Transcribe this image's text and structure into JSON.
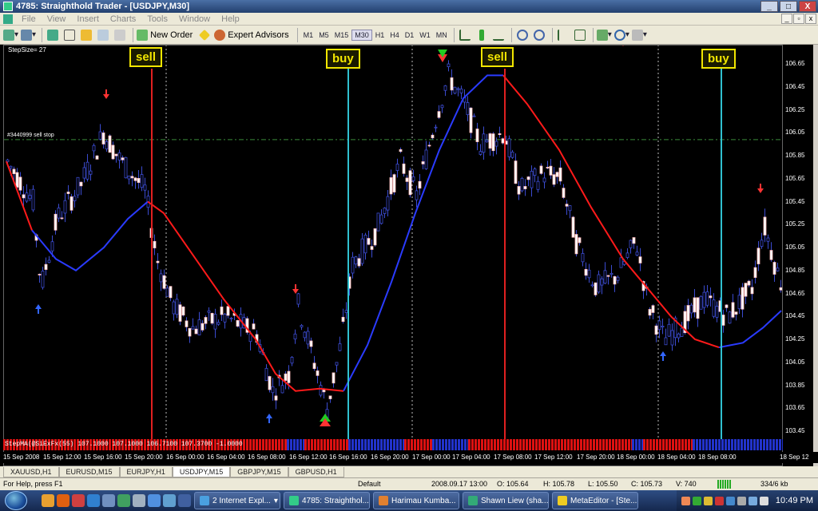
{
  "window": {
    "title": "4785: Straighthold Trader - [USDJPY,M30]",
    "minimize": "_",
    "maximize": "□",
    "close": "X"
  },
  "menu": [
    "File",
    "View",
    "Insert",
    "Charts",
    "Tools",
    "Window",
    "Help"
  ],
  "toolbar": {
    "new_order": "New Order",
    "expert_advisors": "Expert Advisors",
    "timeframes": [
      "M1",
      "M5",
      "M15",
      "M30",
      "H1",
      "H4",
      "D1",
      "W1",
      "MN"
    ],
    "active_timeframe": "M30"
  },
  "chart": {
    "stepsize": "StepSize= 27",
    "sell_stop_label": "#3440999 sell stop",
    "indicator_label": "StepMA(@SiExFx(55) 107.1000 107.1000 106.7100 107.3700 -1.0000",
    "signals": [
      {
        "label": "sell",
        "type": "sell"
      },
      {
        "label": "buy",
        "type": "buy"
      },
      {
        "label": "sell",
        "type": "sell"
      },
      {
        "label": "buy",
        "type": "buy"
      }
    ],
    "price_ticks": [
      "106.65",
      "106.45",
      "106.25",
      "106.05",
      "105.85",
      "105.65",
      "105.45",
      "105.25",
      "105.05",
      "104.85",
      "104.65",
      "104.45",
      "104.25",
      "104.05",
      "103.85",
      "103.65",
      "103.45"
    ],
    "time_ticks": [
      "15 Sep 2008",
      "15 Sep 12:00",
      "15 Sep 16:00",
      "15 Sep 20:00",
      "16 Sep 00:00",
      "16 Sep 04:00",
      "16 Sep 08:00",
      "16 Sep 12:00",
      "16 Sep 16:00",
      "16 Sep 20:00",
      "17 Sep 00:00",
      "17 Sep 04:00",
      "17 Sep 08:00",
      "17 Sep 12:00",
      "17 Sep 20:00",
      "18 Sep 00:00",
      "18 Sep 04:00",
      "18 Sep 08:00",
      "18 Sep 12"
    ],
    "colors": {
      "sell_line": "#e02020",
      "buy_line": "#30c0d0",
      "ma_up": "#2a3bff",
      "ma_down": "#ff1a1a",
      "sellstop": "#3a8a3a",
      "signal": "#f2e600"
    }
  },
  "tabs": [
    "XAUUSD,H1",
    "EURUSD,M15",
    "EURJPY,H1",
    "USDJPY,M15",
    "GBPJPY,M15",
    "GBPUSD,H1"
  ],
  "active_tab": "USDJPY,M15",
  "status": {
    "help": "For Help, press F1",
    "profile": "Default",
    "datetime": "2008.09.17 13:00",
    "open": "O: 105.64",
    "high": "H: 105.78",
    "low": "L: 105.50",
    "close": "C: 105.73",
    "volume": "V: 740",
    "traffic": "334/6 kb"
  },
  "taskbar": {
    "buttons": [
      "2 Internet Expl...",
      "4785: Straighthol...",
      "Harimau Kumba...",
      "Shawn Liew (sha...",
      "MetaEditor - [Ste..."
    ],
    "clock": "10:49 PM"
  }
}
